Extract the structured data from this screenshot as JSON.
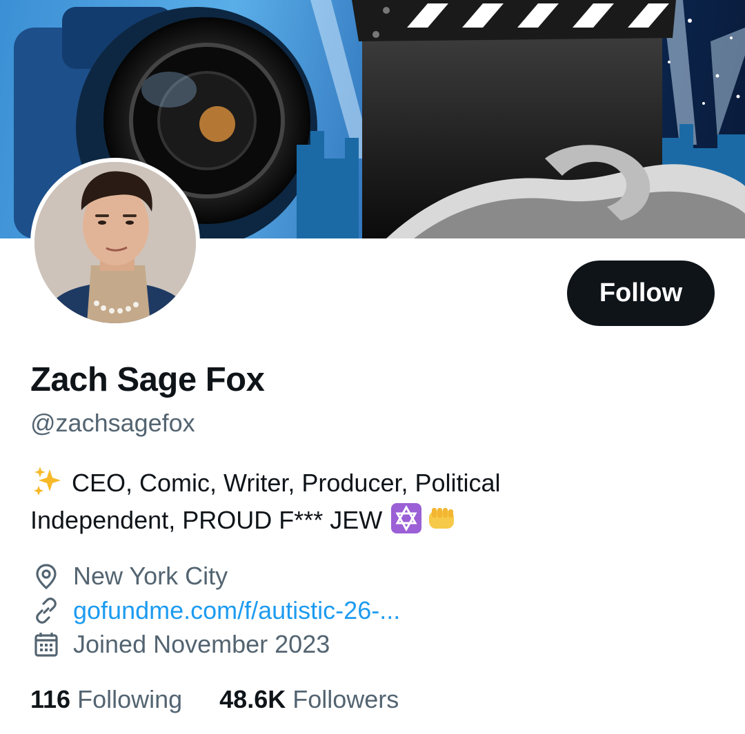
{
  "profile": {
    "display_name": "Zach Sage Fox",
    "handle": "@zachsagefox",
    "follow_label": "Follow",
    "bio": {
      "prefix_emoji": "sparkles",
      "text_line1": "CEO, Comic, Writer, Producer, Political",
      "text_line2": "Independent, PROUD F*** JEW",
      "suffix_emojis": [
        "star-of-david",
        "oncoming-fist"
      ]
    },
    "location": "New York City",
    "website": "gofundme.com/f/autistic-26-...",
    "joined": "Joined November 2023",
    "following_count": "116",
    "following_label": "Following",
    "followers_count": "48.6K",
    "followers_label": "Followers"
  },
  "icons": {
    "location": "location-pin-icon",
    "link": "link-icon",
    "calendar": "calendar-icon"
  },
  "colors": {
    "link": "#1d9bf0",
    "secondary_text": "#536471",
    "button_bg": "#0f1419",
    "emoji_purple": "#9b5fd6",
    "emoji_yellow": "#f7c948"
  }
}
